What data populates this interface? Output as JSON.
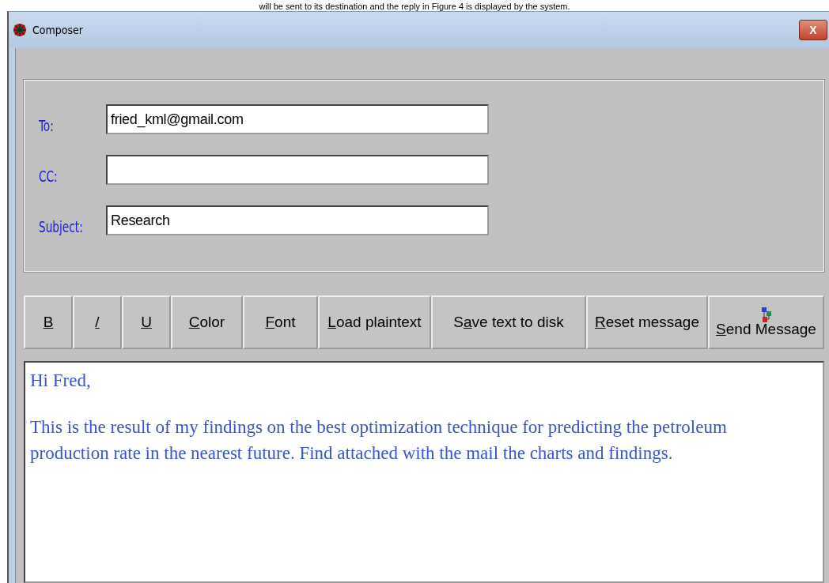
{
  "caption": "will be sent to its destination and the reply in Figure 4 is displayed by the system.",
  "window": {
    "title": "Composer",
    "close": "X"
  },
  "fields": [
    {
      "label": "To:",
      "value": "fried_kml@gmail.com"
    },
    {
      "label": "CC:"
    },
    {
      "label": "Subject:",
      "value": "Research"
    }
  ],
  "toolbar": [
    {
      "key": "B",
      "kind": "text"
    },
    {
      "key": "/",
      "kind": "text"
    },
    {
      "key": "U",
      "kind": "text"
    },
    {
      "key": "C",
      "post": "olor",
      "kind": "text"
    },
    {
      "key": "F",
      "post": "ont",
      "kind": "text"
    },
    {
      "key": "L",
      "post": "oad plaintext",
      "kind": "text"
    },
    {
      "pre": "S",
      "key": "a",
      "post": "ve text to disk",
      "kind": "text"
    },
    {
      "key": "R",
      "post": "eset message",
      "kind": "text"
    },
    {
      "key": "S",
      "post": "end Message",
      "kind": "icon"
    }
  ],
  "message": [
    "Hi Fred,",
    "This is the result of my findings on the best optimization technique for predicting the petroleum production rate in the nearest future.  Find attached with the mail the charts and findings."
  ]
}
